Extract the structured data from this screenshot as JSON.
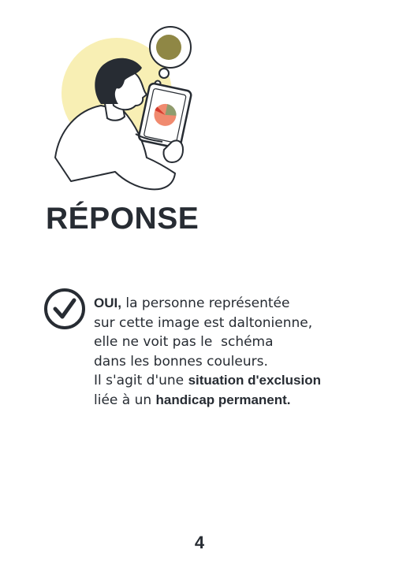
{
  "title": "RÉPONSE",
  "answer": {
    "lead_bold": "OUI,",
    "line1_rest": " la personne représentée",
    "line2": "sur cette image est daltonienne,",
    "line3": "elle ne voit pas le  schéma",
    "line4": "dans les bonnes couleurs.",
    "line5_pre": "Il s'agit d'une ",
    "line5_bold": "situation d'exclusion",
    "line6_pre": "liée à un ",
    "line6_bold": "handicap permanent."
  },
  "page_number": "4",
  "colors": {
    "text": "#272c33",
    "sun": "#f8efb4",
    "bubble_dot": "#8f8745",
    "pie_main": "#f08a6f",
    "pie_slice_green": "#8f9c6e",
    "pie_slice_red": "#d43a2c"
  },
  "icons": [
    "check-circle-icon"
  ]
}
